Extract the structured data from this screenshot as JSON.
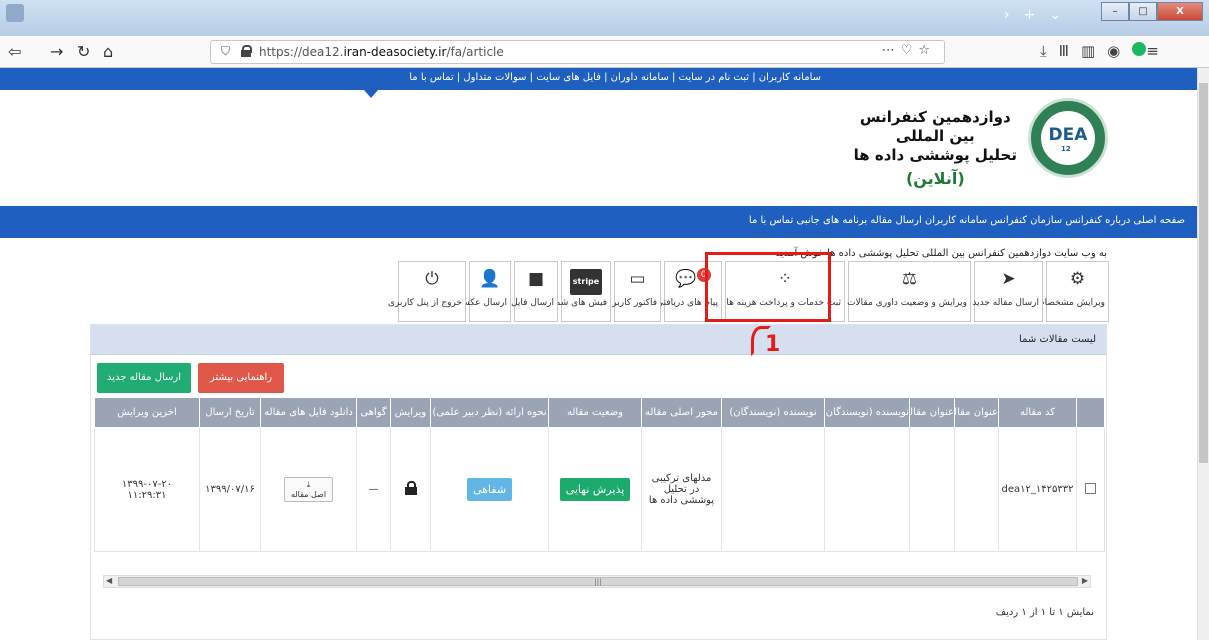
{
  "browser": {
    "url_host_prefix": "https://dea12.",
    "url_host": "iran-deasociety.ir",
    "url_path": "/fa/article",
    "window_buttons": [
      "–",
      "□",
      "X"
    ]
  },
  "top_links": "سامانه کاربران  |  ثبت نام در سایت  |  سامانه داوران  |  فایل های سایت  |  سوالات متداول  |  تماس با ما",
  "header": {
    "logo_text": "DEA",
    "logo_num": "12",
    "title_line1": "دوازدهمین  کنفرانس",
    "title_line2": "بین المللی",
    "title_line3": "تحلیل پوششی داده ها",
    "title_line4": "(آنلاین)"
  },
  "main_nav": "صفحه اصلی   درباره کنفرانس   سازمان کنفرانس   سامانه کاربران   ارسال مقاله   برنامه های جانبی   تماس با ما",
  "welcome": "به وب سایت دوازدهمین کنفرانس بین المللی تحلیل پوششی داده ها خوش آمدید",
  "toolbar": {
    "edit_profile": "ویرایش مشخصات",
    "send_paper": "ارسال مقاله جدید",
    "edit_status": "ویرایش و وضعیت داوری مقالات",
    "services": "ثبت خدمات و پرداخت هزینه ها",
    "messages": "پیام های دریافتی",
    "messages_count": "0",
    "invoice": "فاکتور کاربر",
    "receipts": "فیش های شما",
    "stripe": "stripe",
    "send_file": "ارسال فایل",
    "send_photo": "ارسال عکس",
    "logout": "خروج از پنل کاربری"
  },
  "annotation_number": "1",
  "panel": {
    "title": "لیست مقالات شما",
    "help_button": "راهنمایی بیشتر",
    "new_button": "ارسال مقاله جدید"
  },
  "table": {
    "headers": [
      "کد مقاله",
      "عنوان مقاله",
      "عنوان مقاله",
      "نویسنده (نویسندگان)",
      "نویسنده (نویسندگان)",
      "محور اصلی مقاله",
      "وضعیت مقاله",
      "نحوه ارائه (نظر دبیر علمی)",
      "ویرایش",
      "گواهی",
      "دانلود فایل های مقاله",
      "تاریخ ارسال",
      "اخرین ویرایش"
    ],
    "row": {
      "code": "dea۱۲_۱۴۲۵۳۳۲",
      "axis_1": "مدلهای ترکیبی",
      "axis_2": "در تحلیل",
      "axis_3": "پوششی داده ها",
      "status": "پذیرش نهایی",
      "presentation": "شفاهی",
      "certificate": "—",
      "download_label": "اصل مقاله",
      "sent_date": "۱۳۹۹/۰۷/۱۶",
      "last_edit_date": "۱۳۹۹-۰۷-۲۰",
      "last_edit_time": "۱۱:۲۹:۳۱"
    }
  },
  "info": "نمایش ۱ تا ۱ از ۱ ردیف"
}
